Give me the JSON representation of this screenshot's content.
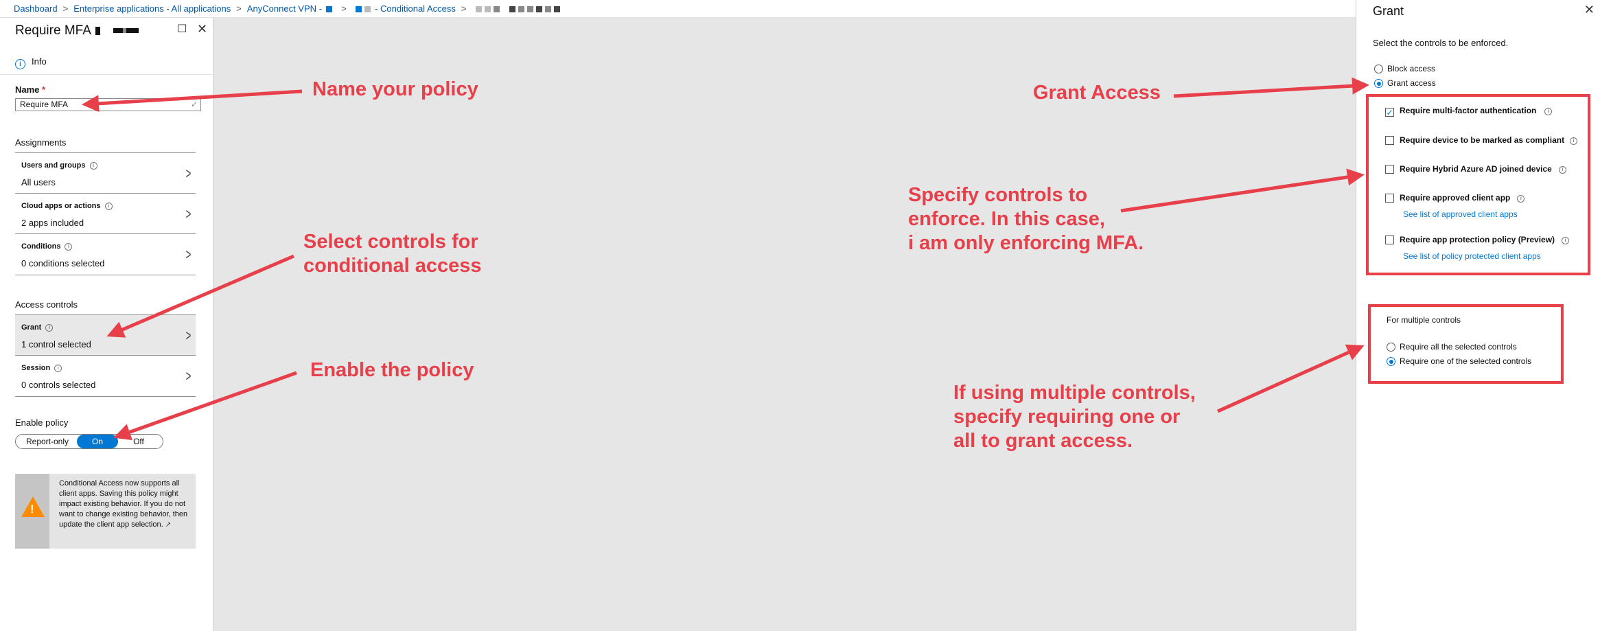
{
  "breadcrumb": {
    "items": [
      "Dashboard",
      "Enterprise applications - All applications",
      "AnyConnect VPN -",
      "- Conditional Access"
    ],
    "separator": ">"
  },
  "policy_blade": {
    "title": "Require MFA",
    "info_label": "Info",
    "name_label": "Name",
    "name_required_marker": "*",
    "name_value": "Require MFA",
    "assignments_heading": "Assignments",
    "assignments": [
      {
        "label": "Users and groups",
        "value": "All users",
        "info_icon": "info-icon"
      },
      {
        "label": "Cloud apps or actions",
        "value": "2 apps included",
        "info_icon": "info-icon"
      },
      {
        "label": "Conditions",
        "value": "0 conditions selected",
        "info_icon": "info-icon"
      }
    ],
    "access_controls_heading": "Access controls",
    "access_controls": [
      {
        "label": "Grant",
        "value": "1 control selected",
        "active": true
      },
      {
        "label": "Session",
        "value": "0 controls selected",
        "active": false
      }
    ],
    "enable_policy_label": "Enable policy",
    "enable_policy_options": [
      "Report-only",
      "On",
      "Off"
    ],
    "enable_policy_selected": "On",
    "notice_text": "Conditional Access now supports all client apps. Saving this policy might impact existing behavior. If you do not want to change existing behavior, then update the client app selection.",
    "notice_icon": "warning-icon"
  },
  "grant_blade": {
    "title": "Grant",
    "instruction": "Select the controls to be enforced.",
    "access_options": [
      {
        "label": "Block access",
        "selected": false
      },
      {
        "label": "Grant access",
        "selected": true
      }
    ],
    "controls": [
      {
        "label": "Require multi-factor authentication",
        "checked": true,
        "link": ""
      },
      {
        "label": "Require device to be marked as compliant",
        "checked": false,
        "link": ""
      },
      {
        "label": "Require Hybrid Azure AD joined device",
        "checked": false,
        "link": ""
      },
      {
        "label": "Require approved client app",
        "checked": false,
        "link": "See list of approved client apps"
      },
      {
        "label": "Require app protection policy (Preview)",
        "checked": false,
        "link": "See list of policy protected client apps"
      }
    ],
    "multiple_controls_title": "For multiple controls",
    "multiple_options": [
      {
        "label": "Require all the selected controls",
        "selected": false
      },
      {
        "label": "Require one of the selected controls",
        "selected": true
      }
    ]
  },
  "annotations": {
    "name_policy": "Name your policy",
    "select_controls": [
      "Select controls for",
      "conditional access"
    ],
    "enable_policy": "Enable the policy",
    "grant_access": "Grant Access",
    "specify_controls": [
      "Specify controls to",
      "enforce. In this case,",
      "i am only enforcing MFA."
    ],
    "multiple_controls": [
      "If using multiple controls,",
      "specify requiring one or",
      "all to grant access."
    ],
    "color": "#e7404a"
  },
  "colors": {
    "accent": "#0078d4",
    "link": "#0058ad",
    "warning": "#ff8c00",
    "annotation": "#e7404a",
    "canvas": "#e6e6e6"
  }
}
